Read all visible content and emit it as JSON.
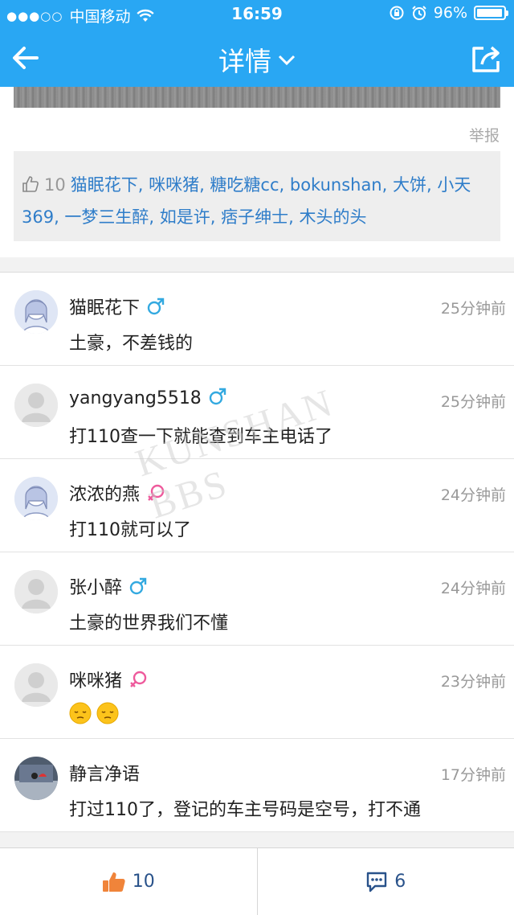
{
  "status_bar": {
    "carrier": "中国移动",
    "signal_dots": "●●●○○",
    "time": "16:59",
    "battery": "96%",
    "battery_level": 0.96
  },
  "nav": {
    "title": "详情"
  },
  "detail": {
    "report_label": "举报",
    "likes_count": "10",
    "likers_text": "猫眠花下, 咪咪猪, 糖吃糖cc, bokunshan, 大饼, 小天369, 一梦三生醉, 如是许, 痞子绅士, 木头的头"
  },
  "comments": [
    {
      "name": "猫眠花下",
      "gender": "male",
      "time": "25分钟前",
      "text": "土豪，不差钱的",
      "avatar": "drawn-girl-avatar"
    },
    {
      "name": "yangyang5518",
      "gender": "male",
      "time": "25分钟前",
      "text": "打110查一下就能查到车主电话了",
      "avatar": "default-avatar"
    },
    {
      "name": "浓浓的燕",
      "gender": "female",
      "time": "24分钟前",
      "text": "打110就可以了",
      "avatar": "drawn-girl-avatar"
    },
    {
      "name": "张小醉",
      "gender": "male",
      "time": "24分钟前",
      "text": "土豪的世界我们不懂",
      "avatar": "default-avatar"
    },
    {
      "name": "咪咪猪",
      "gender": "female",
      "time": "23分钟前",
      "text": "",
      "emojis": [
        "sleepy-face-emoji",
        "sleepy-face-emoji"
      ],
      "avatar": "default-avatar"
    },
    {
      "name": "静言净语",
      "gender": "none",
      "time": "17分钟前",
      "text": "打过110了，登记的车主号码是空号，打不通",
      "avatar": "photo-avatar"
    }
  ],
  "bottom_bar": {
    "like_count": "10",
    "comment_count": "6"
  },
  "watermark": "KUNSHAN BBS",
  "colors": {
    "brand": "#29a7f3",
    "male": "#33a9e0",
    "female": "#ee5a9c",
    "link": "#2f7dc9"
  }
}
